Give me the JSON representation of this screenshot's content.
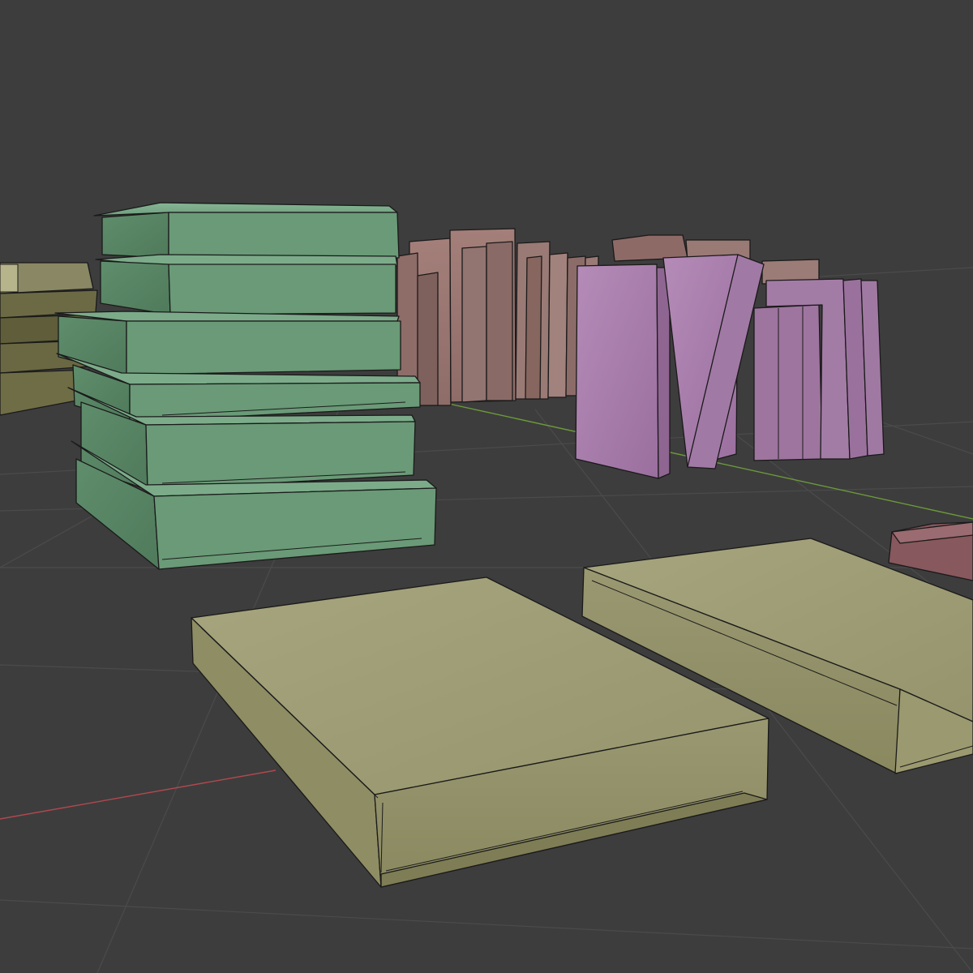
{
  "viewport": {
    "background": "#3d3d3d",
    "grid_color": "#4a4a4a",
    "x_axis_color": "#b2484f",
    "y_axis_color": "#6c9a3a"
  },
  "objects": [
    {
      "name": "green-book-stack",
      "color": "#6ea07d",
      "count": 6
    },
    {
      "name": "olive-book-stack",
      "color": "#75704a",
      "count": 4
    },
    {
      "name": "brown-book-row",
      "color": "#9a7571"
    },
    {
      "name": "purple-book-row",
      "color": "#a87fab"
    },
    {
      "name": "olive-book-front",
      "color": "#a5a47c"
    },
    {
      "name": "olive-book-right",
      "color": "#a5a47c"
    },
    {
      "name": "red-book-edge",
      "color": "#8a5a5f"
    }
  ]
}
